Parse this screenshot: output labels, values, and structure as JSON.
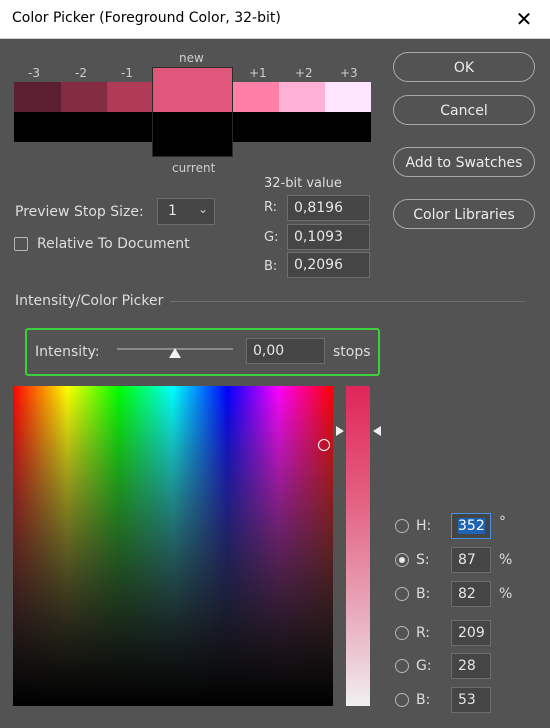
{
  "window": {
    "title": "Color Picker (Foreground Color, 32-bit)"
  },
  "preview": {
    "labels": [
      "-3",
      "-2",
      "-1",
      "new",
      "+1",
      "+2",
      "+3"
    ],
    "current_label": "current",
    "colors": [
      "#5c1f32",
      "#822b41",
      "#b03a56",
      "#e1577b",
      "#ff7fa7",
      "#ffb0d6",
      "#ffe5ff"
    ],
    "current_color": "#000000"
  },
  "buttons": {
    "ok": "OK",
    "cancel": "Cancel",
    "add_swatches": "Add to Swatches",
    "color_libraries": "Color Libraries"
  },
  "value32": {
    "heading": "32-bit value",
    "r_label": "R:",
    "r": "0,8196",
    "g_label": "G:",
    "g": "0,1093",
    "b_label": "B:",
    "b": "0,2096"
  },
  "preview_stop": {
    "label": "Preview Stop Size:",
    "value": "1"
  },
  "relative_doc": {
    "label": "Relative To Document",
    "checked": false
  },
  "section": {
    "title": "Intensity/Color Picker"
  },
  "intensity": {
    "label": "Intensity:",
    "value": "0,00",
    "unit": "stops"
  },
  "hsb": {
    "h_label": "H:",
    "h": "352",
    "h_unit": "°",
    "s_label": "S:",
    "s": "87",
    "s_unit": "%",
    "b_label": "B:",
    "b": "82",
    "b_unit": "%"
  },
  "rgb": {
    "r_label": "R:",
    "r": "209",
    "g_label": "G:",
    "g": "28",
    "b_label": "B:",
    "b": "53"
  },
  "colors": {
    "accent_green": "#3ccf3c",
    "hue_strip_top": "#e0265a",
    "selection_blue": "#1f64b4"
  }
}
